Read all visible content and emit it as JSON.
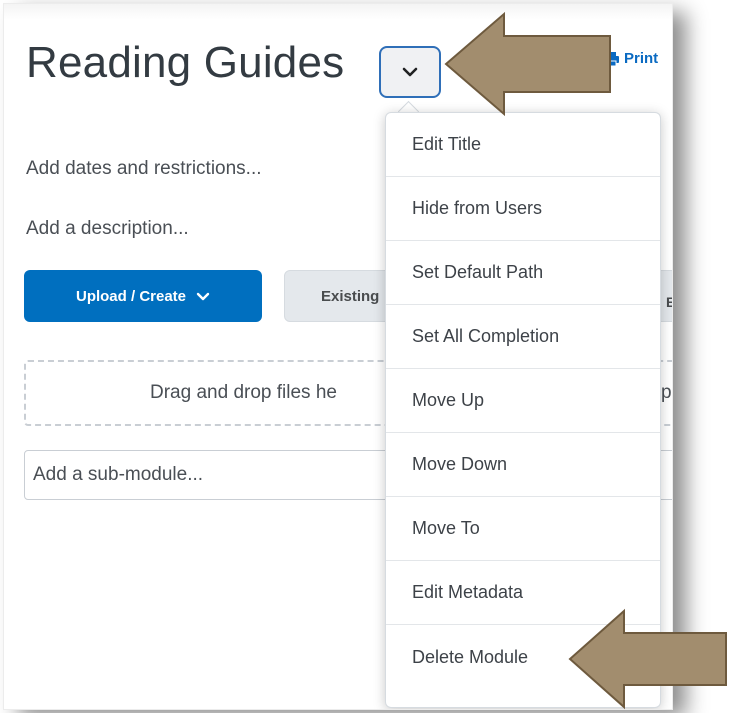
{
  "header": {
    "title": "Reading Guides",
    "print_label": "Print",
    "toggle_icon": "chevron-down-icon"
  },
  "module": {
    "dates_link": "Add dates and restrictions...",
    "description_link": "Add a description...",
    "upload_label": "Upload / Create",
    "existing_label": "Existing",
    "existing_tail": "E",
    "dropzone_text": "Drag and drop files he",
    "dropzone_tail": "p",
    "submodule_placeholder": "Add a sub-module..."
  },
  "menu": {
    "items": [
      {
        "label": "Edit Title"
      },
      {
        "label": "Hide from Users"
      },
      {
        "label": "Set Default Path"
      },
      {
        "label": "Set All Completion"
      },
      {
        "label": "Move Up"
      },
      {
        "label": "Move Down"
      },
      {
        "label": "Move To"
      },
      {
        "label": "Edit Metadata"
      },
      {
        "label": "Delete Module"
      }
    ]
  },
  "colors": {
    "primary": "#006fbf",
    "arrow_fill": "#a28d6e",
    "arrow_stroke": "#6e5a3e"
  }
}
